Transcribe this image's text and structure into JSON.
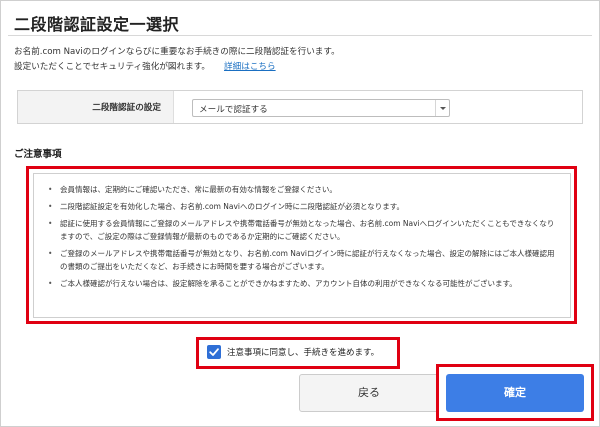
{
  "page": {
    "title": "二段階認証設定一選択",
    "intro_line1": "お名前.com Naviのログインならびに重要なお手続きの際に二段階認証を行います。",
    "intro_line2": "設定いただくことでセキュリティ強化が図れます。",
    "detail_link": "詳細はこちら"
  },
  "setting": {
    "label": "二段階認証の設定",
    "selected_value": "メールで認証する"
  },
  "notes": {
    "heading": "ご注意事項",
    "items": [
      "会員情報は、定期的にご確認いただき、常に最新の有効な情報をご登録ください。",
      "二段階認証設定を有効化した場合、お名前.com Naviへのログイン時に二段階認証が必須となります。",
      "認証に使用する会員情報にご登録のメールアドレスや携帯電話番号が無効となった場合、お名前.com Naviへログインいただくこともできなくなりますので、ご設定の際はご登録情報が最新のものであるか定期的にご確認ください。",
      "ご登録のメールアドレスや携帯電話番号が無効となり、お名前.com Naviログイン時に認証が行えなくなった場合、設定の解除にはご本人様確認用の書類のご提出をいただくなど、お手続きにお時間を要する場合がございます。",
      "ご本人様確認が行えない場合は、設定解除を承ることができかねますため、アカウント自体の利用ができなくなる可能性がございます。"
    ]
  },
  "agree": {
    "checked": true,
    "label": "注意事項に同意し、手続きを進めます。"
  },
  "buttons": {
    "back_label": "戻る",
    "confirm_label": "確定"
  },
  "colors": {
    "highlight": "#e00012",
    "primary": "#3d7ee6",
    "checkbox": "#2f6fd6",
    "link": "#1a6fc2"
  }
}
